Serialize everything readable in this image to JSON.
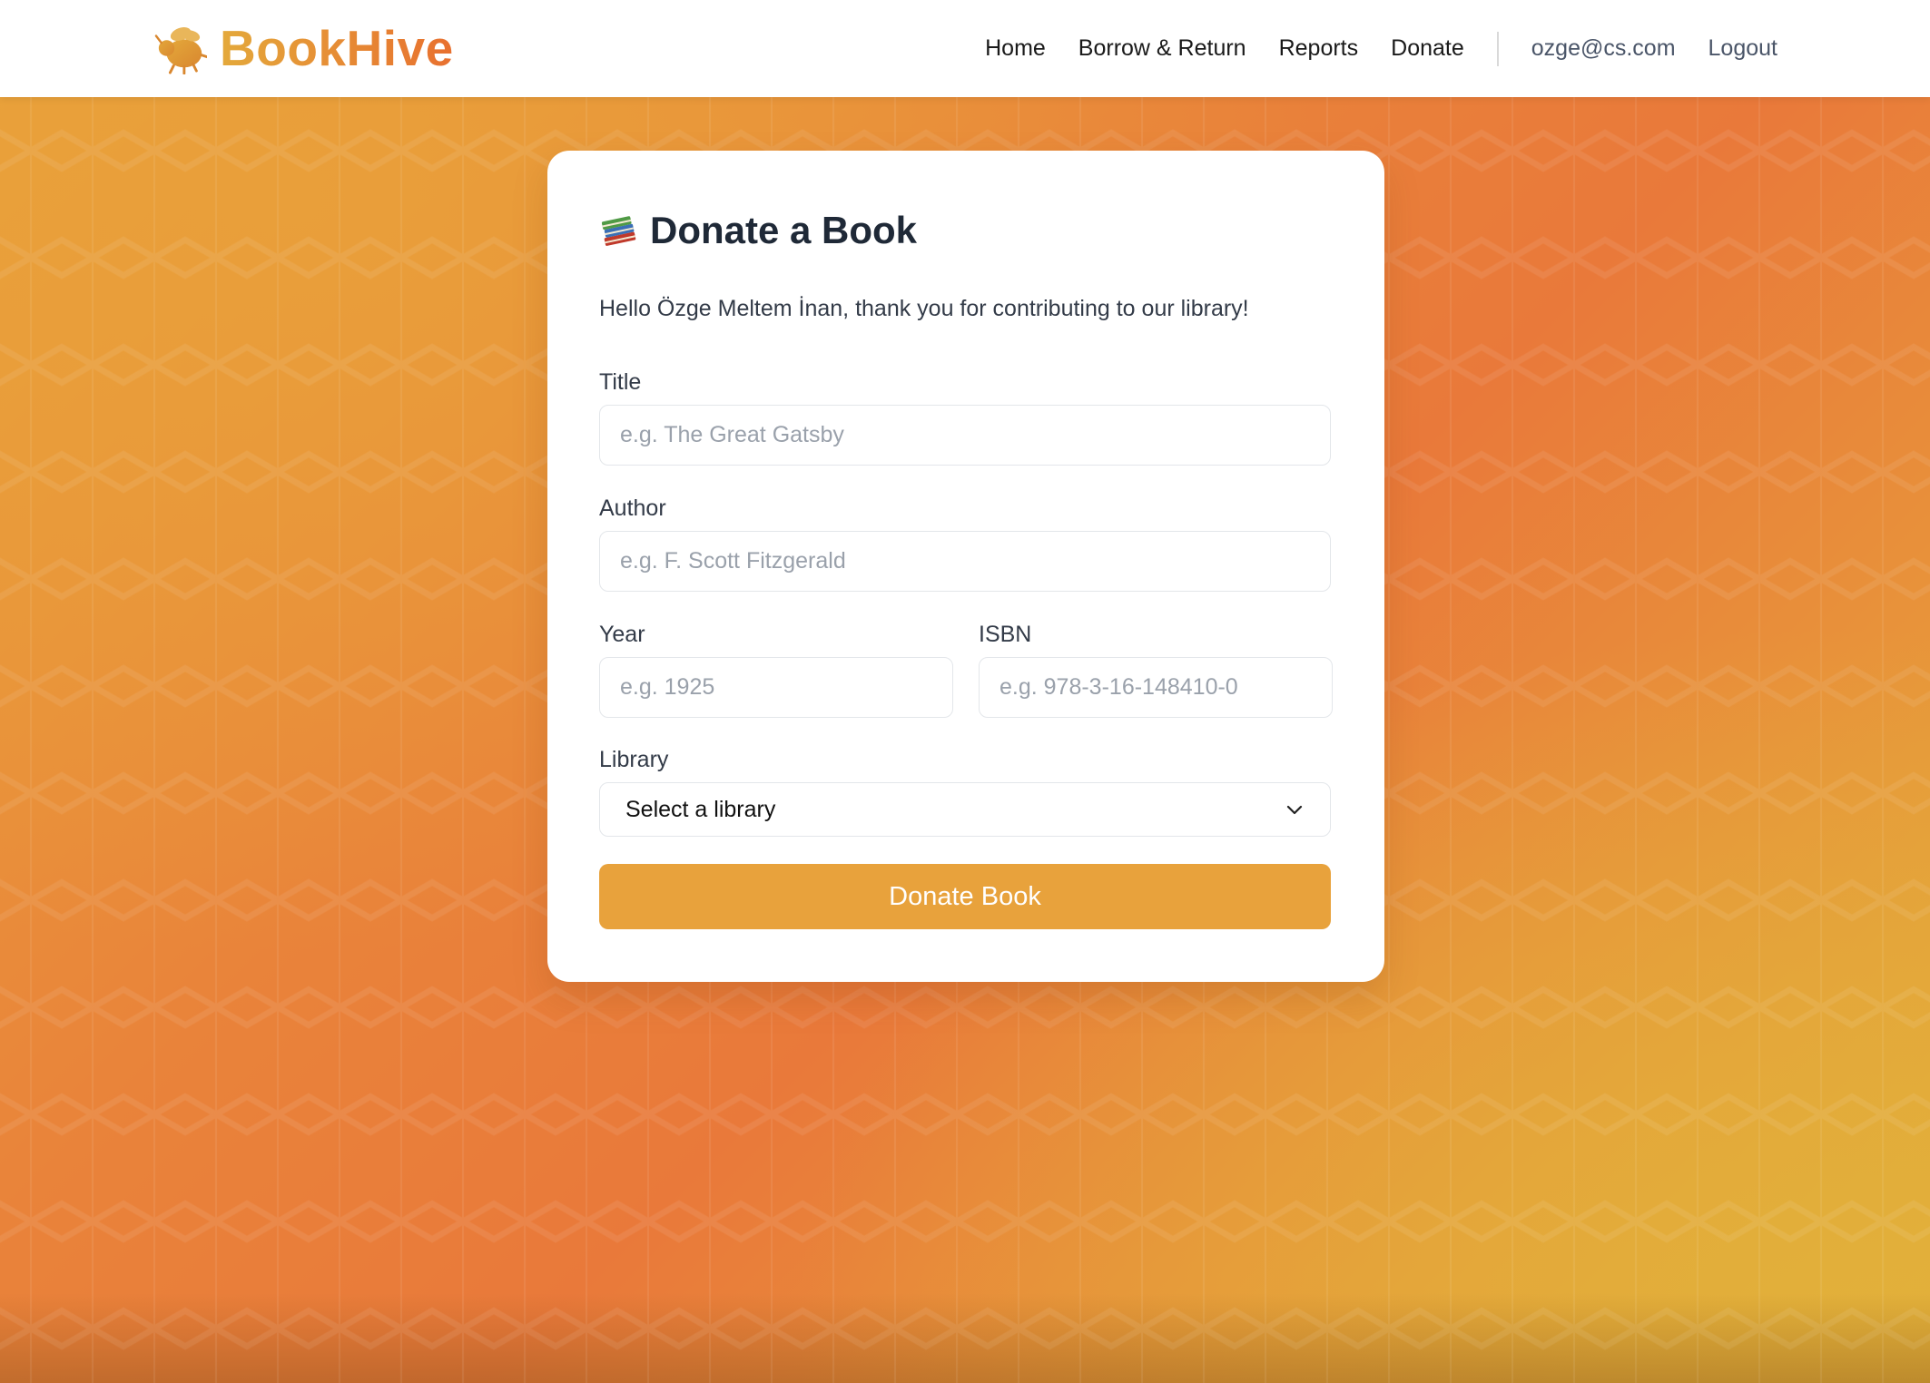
{
  "brand": {
    "name": "BookHive",
    "logo_icon": "bee-icon"
  },
  "nav": {
    "links": [
      "Home",
      "Borrow & Return",
      "Reports",
      "Donate"
    ],
    "user_email": "ozge@cs.com",
    "logout": "Logout"
  },
  "colors": {
    "accent": "#e8a23c",
    "background_gradient": [
      "#e9a23a",
      "#e9793a",
      "#e2b03a"
    ],
    "title_text": "#1f2937"
  },
  "page": {
    "title": "Donate a Book",
    "title_icon": "books-icon",
    "greeting": "Hello Özge Meltem İnan, thank you for contributing to our library!"
  },
  "form": {
    "title": {
      "label": "Title",
      "placeholder": "e.g. The Great Gatsby",
      "value": ""
    },
    "author": {
      "label": "Author",
      "placeholder": "e.g. F. Scott Fitzgerald",
      "value": ""
    },
    "year": {
      "label": "Year",
      "placeholder": "e.g. 1925",
      "value": ""
    },
    "isbn": {
      "label": "ISBN",
      "placeholder": "e.g. 978-3-16-148410-0",
      "value": ""
    },
    "library": {
      "label": "Library",
      "selected": "Select a library"
    },
    "submit_label": "Donate Book"
  }
}
